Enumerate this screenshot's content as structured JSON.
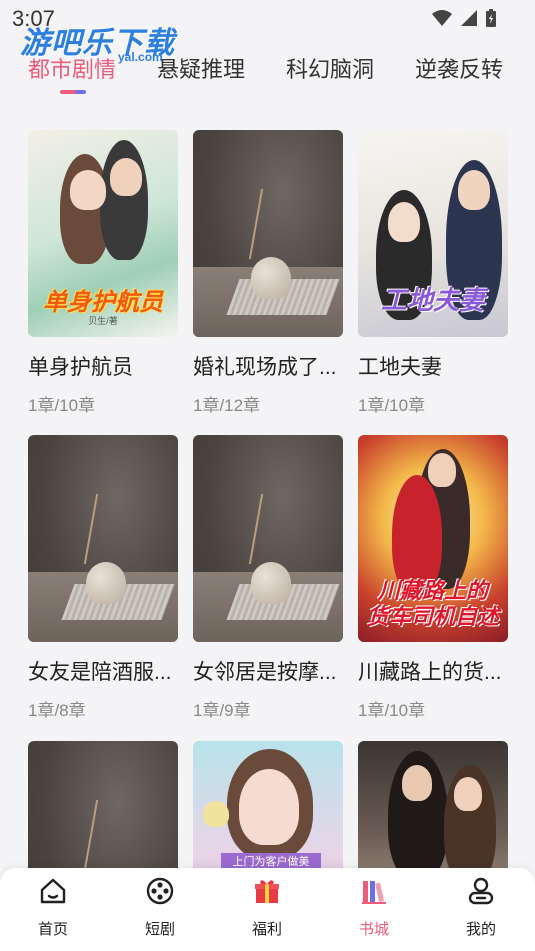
{
  "status": {
    "time": "3:07"
  },
  "watermark": {
    "text": "游吧乐下载",
    "sub": "yal.com"
  },
  "tabs": [
    {
      "label": "都市剧情",
      "active": true
    },
    {
      "label": "悬疑推理",
      "active": false
    },
    {
      "label": "科幻脑洞",
      "active": false
    },
    {
      "label": "逆袭反转",
      "active": false
    }
  ],
  "books": [
    {
      "title": "单身护航员",
      "progress": "1章/10章",
      "cover_text": "单身护航员",
      "cover_author": "贝生/著"
    },
    {
      "title": "婚礼现场成了...",
      "progress": "1章/12章"
    },
    {
      "title": "工地夫妻",
      "progress": "1章/10章",
      "cover_text": "工地夫妻"
    },
    {
      "title": "女友是陪酒服...",
      "progress": "1章/8章"
    },
    {
      "title": "女邻居是按摩...",
      "progress": "1章/9章"
    },
    {
      "title": "川藏路上的货...",
      "progress": "1章/10章",
      "cover_text_1": "川藏路上的",
      "cover_text_2": "货车司机自述"
    },
    {
      "title": "",
      "progress": ""
    },
    {
      "title": "",
      "progress": "",
      "cover_text": "上门为客户做美"
    },
    {
      "title": "",
      "progress": ""
    }
  ],
  "nav": [
    {
      "label": "首页",
      "icon": "home-icon",
      "active": false
    },
    {
      "label": "短剧",
      "icon": "film-reel-icon",
      "active": false
    },
    {
      "label": "福利",
      "icon": "gift-icon",
      "active": false
    },
    {
      "label": "书城",
      "icon": "bookshelf-icon",
      "active": true
    },
    {
      "label": "我的",
      "icon": "profile-icon",
      "active": false
    }
  ],
  "colors": {
    "accent": "#ee5c7c",
    "accent2": "#6f6fe8",
    "background": "#f4f4f6"
  }
}
